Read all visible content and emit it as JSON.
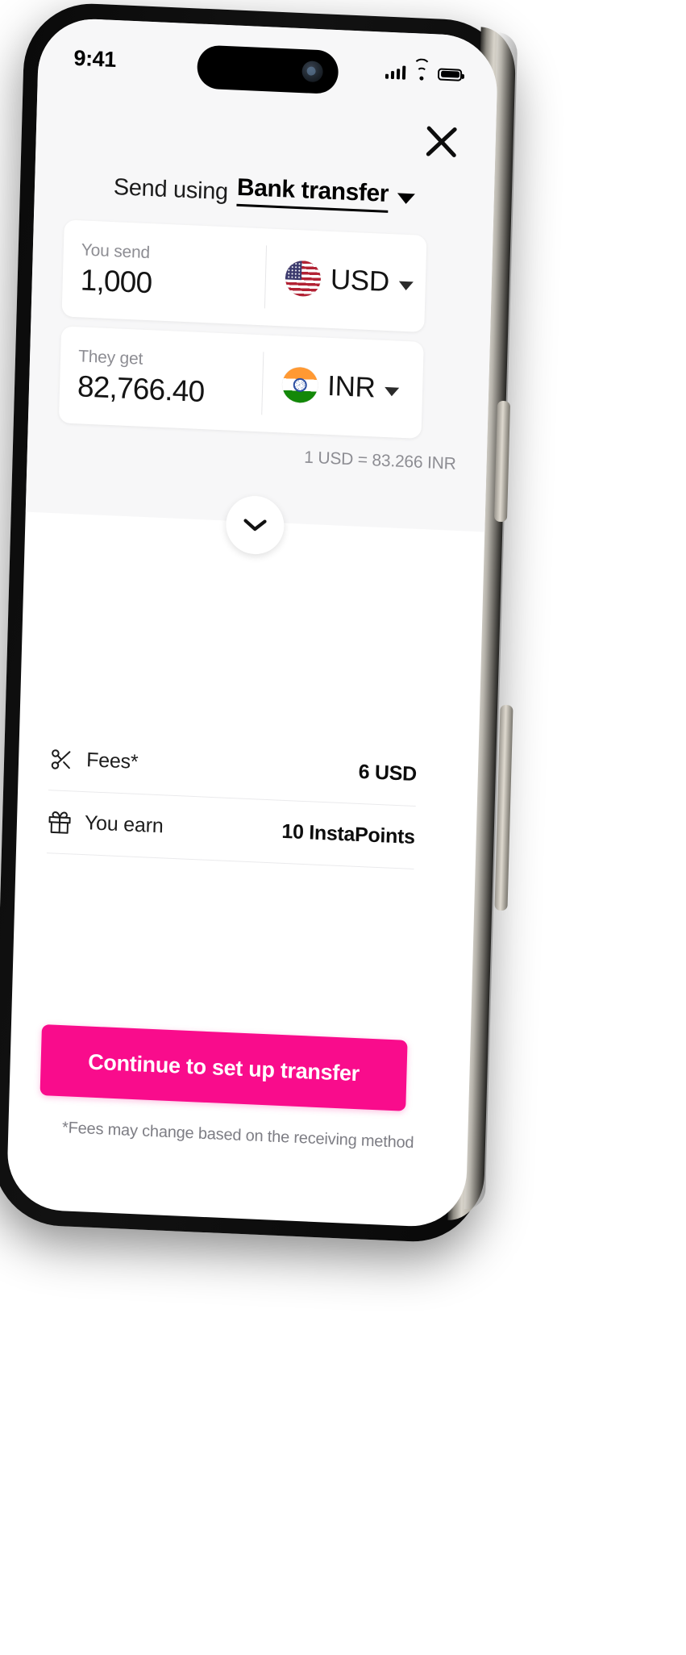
{
  "status_bar": {
    "time": "9:41",
    "signal_icon": "cellular-signal-icon",
    "wifi_icon": "wifi-icon",
    "battery_icon": "battery-full-icon"
  },
  "header": {
    "close_icon": "close-icon",
    "send_using_label": "Send using",
    "send_using_value": "Bank transfer",
    "dropdown_caret_icon": "caret-down-icon"
  },
  "amount_cards": [
    {
      "label": "You send",
      "amount": "1,000",
      "currency": "USD",
      "flag": "us-flag-icon",
      "chevron_icon": "chevron-down-icon"
    },
    {
      "label": "They get",
      "amount": "82,766.40",
      "currency": "INR",
      "flag": "in-flag-icon",
      "chevron_icon": "chevron-down-icon"
    }
  ],
  "exchange_rate": "1 USD = 83.266 INR",
  "expand_handle_icon": "chevron-down-icon",
  "detail_rows": [
    {
      "icon": "scissors-icon",
      "label": "Fees*",
      "value": "6 USD"
    },
    {
      "icon": "gift-icon",
      "label": "You earn",
      "value": "10 InstaPoints"
    }
  ],
  "cta": {
    "label": "Continue to set up transfer",
    "color": "#f90c8c"
  },
  "footnote": "*Fees may change based on the receiving method"
}
